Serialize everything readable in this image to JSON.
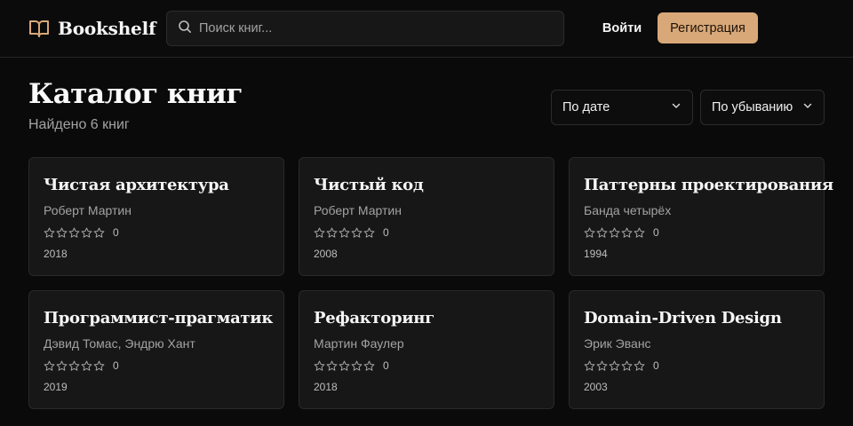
{
  "header": {
    "logo_text": "Bookshelf",
    "search_placeholder": "Поиск книг...",
    "login_label": "Войти",
    "register_label": "Регистрация"
  },
  "catalog": {
    "title": "Каталог книг",
    "count_text": "Найдено 6 книг",
    "sort_field": "По дате",
    "sort_order": "По убыванию"
  },
  "books": [
    {
      "title": "Чистая архитектура",
      "author": "Роберт Мартин",
      "rating": 0,
      "rating_count": "0",
      "year": "2018"
    },
    {
      "title": "Чистый код",
      "author": "Роберт Мартин",
      "rating": 0,
      "rating_count": "0",
      "year": "2008"
    },
    {
      "title": "Паттерны проектирования",
      "author": "Банда четырёх",
      "rating": 0,
      "rating_count": "0",
      "year": "1994"
    },
    {
      "title": "Программист-прагматик",
      "author": "Дэвид Томас, Эндрю Хант",
      "rating": 0,
      "rating_count": "0",
      "year": "2019"
    },
    {
      "title": "Рефакторинг",
      "author": "Мартин Фаулер",
      "rating": 0,
      "rating_count": "0",
      "year": "2018"
    },
    {
      "title": "Domain-Driven Design",
      "author": "Эрик Эванс",
      "rating": 0,
      "rating_count": "0",
      "year": "2003"
    }
  ],
  "icons": {
    "logo": "open-book-icon",
    "search": "search-icon",
    "dropdown": "chevron-down-icon",
    "rating": "star-outline-icon"
  },
  "colors": {
    "accent": "#d9a878",
    "background": "#0a0a0a",
    "card": "#171717"
  }
}
